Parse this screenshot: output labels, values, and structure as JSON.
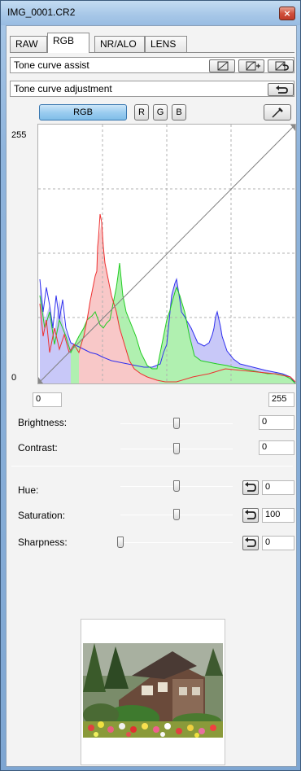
{
  "window": {
    "title": "IMG_0001.CR2",
    "close_glyph": "×"
  },
  "tabs": [
    {
      "label": "RAW",
      "active": false
    },
    {
      "label": "RGB",
      "active": true
    },
    {
      "label": "NR/ALO",
      "active": false
    },
    {
      "label": "LENS",
      "active": false
    }
  ],
  "tone_curve_assist": {
    "label": "Tone curve assist"
  },
  "tone_curve_adjustment": {
    "label": "Tone curve adjustment"
  },
  "channels": {
    "rgb": "RGB",
    "r": "R",
    "g": "G",
    "b": "B"
  },
  "curve": {
    "y_max_label": "255",
    "y_min_label": "0",
    "input_min": "0",
    "input_max": "255"
  },
  "adjustments": {
    "brightness": {
      "label": "Brightness:",
      "value": "0",
      "position": 0.5
    },
    "contrast": {
      "label": "Contrast:",
      "value": "0",
      "position": 0.5
    },
    "hue": {
      "label": "Hue:",
      "value": "0",
      "position": 0.5
    },
    "saturation": {
      "label": "Saturation:",
      "value": "100",
      "position": 0.5
    },
    "sharpness": {
      "label": "Sharpness:",
      "value": "0",
      "position": 0.0
    }
  },
  "colors": {
    "red_channel": "#ee3030",
    "green_channel": "#22cc22",
    "blue_channel": "#3030ee",
    "blue_fill": "#c8c8f8",
    "red_fill": "#f8c8c8",
    "green_fill": "#b0f0b0",
    "accent": "#7fbde8"
  }
}
